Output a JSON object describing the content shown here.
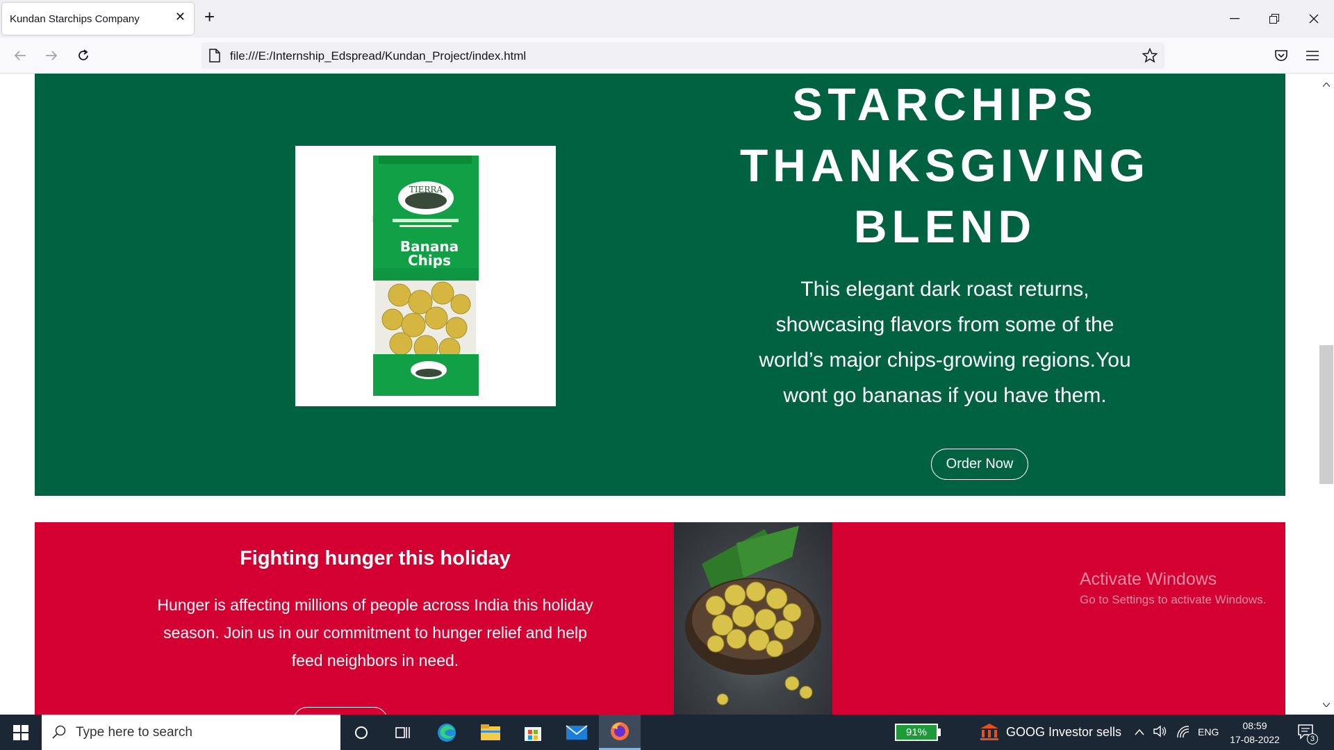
{
  "browser": {
    "tab_title": "Kundan Starchips Company",
    "url": "file:///E:/Internship_Edspread/Kundan_Project/index.html"
  },
  "hero": {
    "title_lines": [
      "STARCHIPS",
      "THANKSGIVING",
      "BLEND"
    ],
    "description": "This elegant dark roast returns, showcasing flavors from some of the world’s major chips-growing regions.You wont go bananas if you have them.",
    "order_button": "Order Now",
    "product_image": {
      "brand": "TIERRA",
      "label_line1": "Banana",
      "label_line2": "Chips"
    }
  },
  "holiday": {
    "title": "Fighting hunger this holiday",
    "description": "Hunger is affecting millions of people across India this holiday season. Join us in our commitment to hunger relief and help feed neighbors in need."
  },
  "watermark": {
    "line1": "Activate Windows",
    "line2": "Go to Settings to activate Windows."
  },
  "taskbar": {
    "search_placeholder": "Type here to search",
    "battery": "91%",
    "ticker": "GOOG  Investor sells",
    "language": "ENG",
    "time": "08:59",
    "date": "17-08-2022",
    "notifications": "3"
  },
  "colors": {
    "green": "#006241",
    "red": "#d50032"
  }
}
